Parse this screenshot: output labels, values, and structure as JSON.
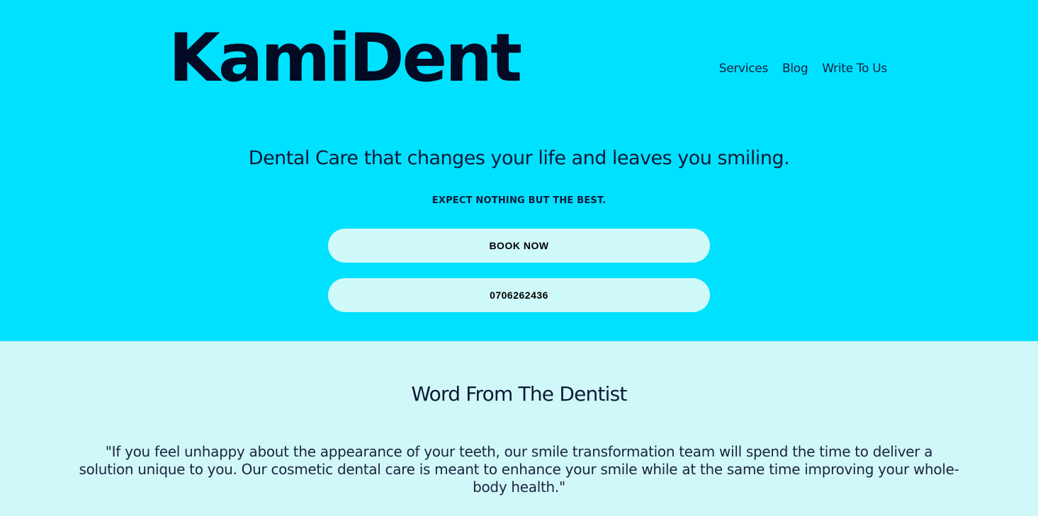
{
  "header": {
    "logo_text": "KamiDent",
    "nav": [
      {
        "label": "Services"
      },
      {
        "label": "Blog"
      },
      {
        "label": "Write To Us"
      }
    ]
  },
  "hero": {
    "tagline": "Dental Care that changes your life and leaves you smiling.",
    "subline": "EXPECT NOTHING BUT THE BEST.",
    "book_button": "BOOK NOW",
    "phone_button": "0706262436"
  },
  "dentist_section": {
    "title": "Word From The Dentist",
    "quote": "\"If you feel unhappy about the appearance of your teeth, our smile transformation team will spend the time to deliver a solution unique to you. Our cosmetic dental care is meant to enhance your smile while at the same time improving your whole-body health.\""
  },
  "colors": {
    "hero_background": "#00e1ff",
    "section_background": "#d1f8f8",
    "button_background": "#d0fafa",
    "text_dark": "#020a24"
  }
}
